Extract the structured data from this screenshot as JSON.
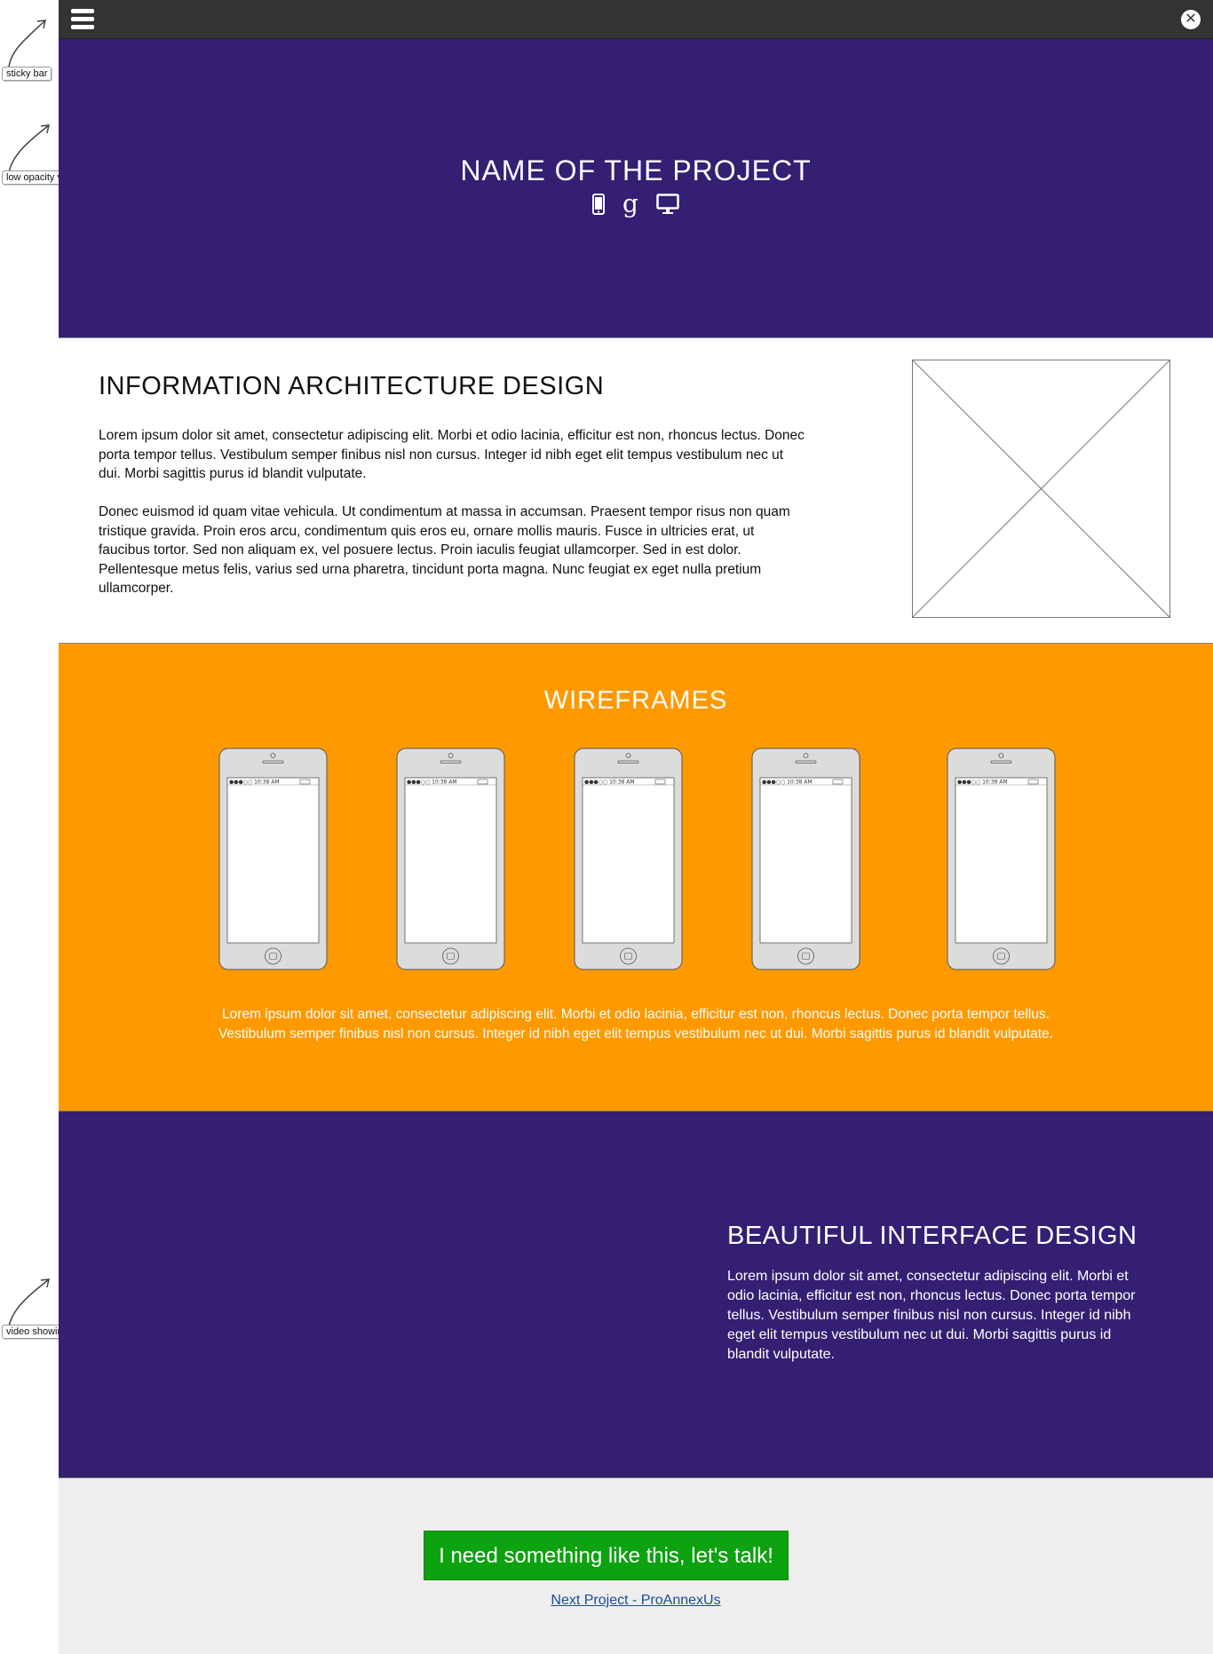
{
  "annotations": {
    "sticky_bar": "sticky bar",
    "hero_video": "low opacity video showing project",
    "product_video": "video showing the actual product in use"
  },
  "topbar": {
    "menu_icon": "menu-icon",
    "close_icon": "close-icon"
  },
  "hero": {
    "title": "NAME OF THE PROJECT",
    "platform_icons": [
      "mobile-icon",
      "google-icon",
      "desktop-icon"
    ],
    "google_glyph": "g"
  },
  "ia": {
    "title": "INFORMATION ARCHITECTURE DESIGN",
    "paragraph1": "Lorem ipsum dolor sit amet, consectetur adipiscing elit. Morbi et odio lacinia, efficitur est non, rhoncus lectus. Donec porta tempor tellus. Vestibulum semper finibus nisl non cursus. Integer id nibh eget elit tempus vestibulum nec ut dui. Morbi sagittis purus id blandit vulputate.",
    "paragraph2": "Donec euismod id quam vitae vehicula. Ut condimentum at massa in accumsan. Praesent tempor risus non quam tristique gravida. Proin eros arcu, condimentum quis eros eu, ornare mollis mauris. Fusce in ultricies erat, ut faucibus tortor. Sed non aliquam ex, vel posuere lectus. Proin iaculis feugiat ullamcorper. Sed in est dolor. Pellentesque metus felis, varius sed urna pharetra, tincidunt porta magna. Nunc feugiat ex eget nulla pretium ullamcorper."
  },
  "wireframes": {
    "title": "WIREFRAMES",
    "phone_status": "●●●○○ 10:38 AM",
    "text": "Lorem ipsum dolor sit amet, consectetur adipiscing elit. Morbi et odio lacinia, efficitur est non, rhoncus lectus. Donec porta tempor tellus. Vestibulum semper finibus nisl non cursus. Integer id nibh eget elit tempus vestibulum nec ut dui. Morbi sagittis purus id blandit vulputate."
  },
  "interface": {
    "title": "BEAUTIFUL INTERFACE DESIGN",
    "text": "Lorem ipsum dolor sit amet, consectetur adipiscing elit. Morbi et odio lacinia, efficitur est non, rhoncus lectus. Donec porta tempor tellus. Vestibulum semper finibus nisl non cursus. Integer id nibh eget elit tempus vestibulum nec ut dui. Morbi sagittis purus id blandit vulputate."
  },
  "footer": {
    "cta_label": "I need something like this, let's talk!",
    "next_link": "Next Project - ProAnnexUs"
  },
  "colors": {
    "topbar": "#333333",
    "purple": "#341f73",
    "orange": "#ff9900",
    "green": "#0da20f",
    "footer_bg": "#eeeeee",
    "link": "#1c4a9a"
  }
}
